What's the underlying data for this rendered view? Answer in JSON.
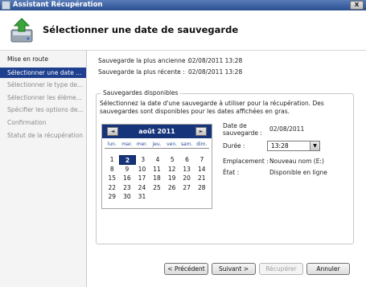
{
  "window": {
    "title": "Assistant Récupération",
    "close_glyph": "x"
  },
  "header": {
    "title": "Sélectionner une date de sauvegarde",
    "icon": "backup-restore-icon"
  },
  "steps": [
    {
      "label": "Mise en route",
      "state": "group"
    },
    {
      "label": "Sélectionner une date ...",
      "state": "active"
    },
    {
      "label": "Sélectionner le type de...",
      "state": "disabled"
    },
    {
      "label": "Sélectionner les éléme...",
      "state": "disabled"
    },
    {
      "label": "Spécifier les options de...",
      "state": "disabled"
    },
    {
      "label": "Confirmation",
      "state": "disabled"
    },
    {
      "label": "Statut de la récupération",
      "state": "disabled"
    }
  ],
  "info": {
    "oldest_label": "Sauvegarde la plus ancienne :",
    "oldest_value": "02/08/2011 13:28",
    "newest_label": "Sauvegarde la plus récente :",
    "newest_value": "02/08/2011 13:28"
  },
  "group": {
    "legend": "Sauvegardes disponibles",
    "description": "Sélectionnez la date d'une sauvegarde à utiliser pour la récupération. Des sauvegardes sont disponibles pour les dates affichées en gras."
  },
  "calendar": {
    "month_label": "août 2011",
    "prev_glyph": "◄",
    "next_glyph": "►",
    "weekdays": [
      "lun.",
      "mar.",
      "mer.",
      "jeu.",
      "ven.",
      "sam.",
      "dim."
    ],
    "weeks": [
      [
        "1",
        "2",
        "3",
        "4",
        "5",
        "6",
        "7"
      ],
      [
        "8",
        "9",
        "10",
        "11",
        "12",
        "13",
        "14"
      ],
      [
        "15",
        "16",
        "17",
        "18",
        "19",
        "20",
        "21"
      ],
      [
        "22",
        "23",
        "24",
        "25",
        "26",
        "27",
        "28"
      ],
      [
        "29",
        "30",
        "31",
        "",
        "",
        "",
        ""
      ]
    ],
    "selected_day": "2"
  },
  "details": {
    "date_label_1": "Date de",
    "date_label_2": "sauvegarde :",
    "date_value": "02/08/2011",
    "duree_label": "Durée :",
    "duree_value": "13:28",
    "duree_arrow": "▼",
    "location_label": "Emplacement :",
    "location_value": "Nouveau nom (E:)",
    "state_label": "État :",
    "state_value": "Disponible en ligne"
  },
  "buttons": {
    "previous": "< Précédent",
    "next": "Suivant >",
    "recover": "Récupérer",
    "cancel": "Annuler"
  },
  "colors": {
    "accent": "#1f3f8f",
    "calendar_header": "#16347a",
    "titlebar": "#2a4f92"
  }
}
